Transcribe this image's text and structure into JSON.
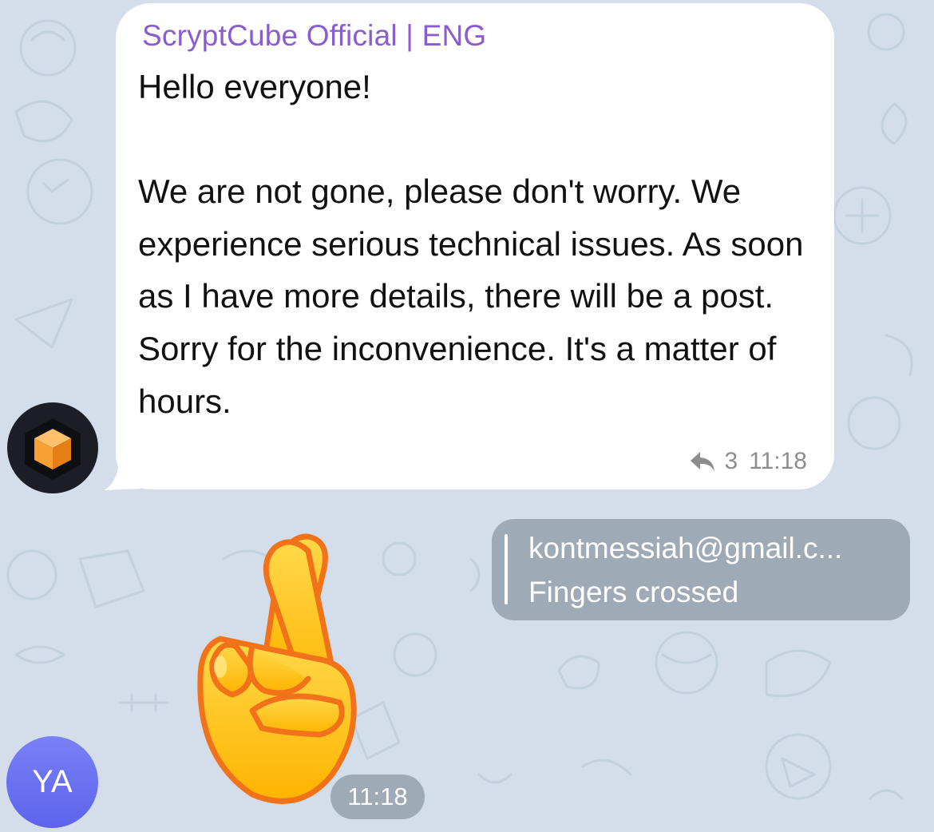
{
  "channel_message": {
    "sender_name": "ScryptCube Official | ENG",
    "text": "Hello everyone!\n\nWe are not gone, please don't worry. We experience serious technical issues. As soon as I have more details, there will be a post. Sorry for the inconvenience. It's a matter of hours.",
    "forward_count": "3",
    "time": "11:18",
    "forward_icon": "share-arrow-icon",
    "avatar_icon": "orange-cube-logo"
  },
  "reply_message": {
    "reply_author": "kontmessiah@gmail.c...",
    "reply_text": "Fingers crossed",
    "sticker": "crossed-fingers-emoji",
    "time": "11:18"
  },
  "user_avatar": {
    "initials": "YA"
  },
  "colors": {
    "background": "#d3deea",
    "sender_name": "#8a5cd0",
    "avatar_ya": "#6a70f0"
  }
}
